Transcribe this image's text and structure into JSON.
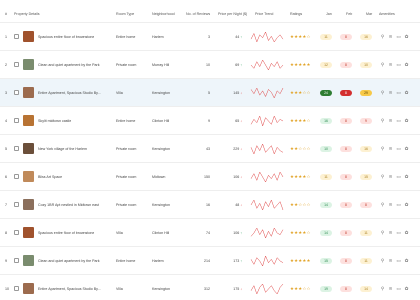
{
  "headers": {
    "idx": "#",
    "property": "Property Details",
    "room": "Room Type",
    "hood": "Neighborhood",
    "reviews": "No. of Reviews",
    "price": "Price per Night ($)",
    "trend": "Price Trend",
    "ratings": "Ratings",
    "jan": "Jan",
    "feb": "Feb",
    "mar": "Mar",
    "amenities": "Amenities"
  },
  "rows": [
    {
      "idx": "1",
      "name": "Spacious entire floor of brownstone",
      "room": "Entire home",
      "hood": "Harlem",
      "reviews": "3",
      "price": "44",
      "dir": "up",
      "stars": "★★★★☆",
      "jan": "11",
      "feb": "8",
      "mar": "16",
      "jan_c": "b-yellow",
      "feb_c": "b-red",
      "mar_c": "b-yellow",
      "thumb": "#a0522d",
      "spark": [
        5,
        9,
        3,
        8,
        6,
        10,
        4,
        7,
        3,
        6,
        8,
        5
      ]
    },
    {
      "idx": "2",
      "name": "Clean and quiet apartment by the Park",
      "room": "Private room",
      "hood": "Murray Hill",
      "reviews": "10",
      "price": "69",
      "dir": "up",
      "stars": "★★★★★",
      "jan": "12",
      "feb": "8",
      "mar": "10",
      "jan_c": "b-yellow",
      "feb_c": "b-red",
      "mar_c": "b-yellow",
      "thumb": "#7a8c6e",
      "spark": [
        6,
        4,
        8,
        5,
        9,
        6,
        3,
        7,
        5,
        8,
        4,
        6
      ]
    },
    {
      "idx": "3",
      "name": "Entire Apartment, Spacious Studio By...",
      "room": "Villa",
      "hood": "Kensington",
      "reviews": "5",
      "price": "145",
      "dir": "down",
      "stars": "★★★☆☆",
      "jan": "24",
      "feb": "8",
      "mar": "29",
      "jan_c": "b-green-solid",
      "feb_c": "b-red-solid",
      "mar_c": "b-yellow-solid",
      "thumb": "#9c6b4e",
      "spark": [
        8,
        5,
        9,
        4,
        7,
        3,
        8,
        6,
        2,
        7,
        5,
        9
      ],
      "selected": true
    },
    {
      "idx": "4",
      "name": "Skylit midtown castle",
      "room": "Entire home",
      "hood": "Clinton Hill",
      "reviews": "9",
      "price": "65",
      "dir": "down",
      "stars": "★★★★☆",
      "jan": "16",
      "feb": "8",
      "mar": "9",
      "jan_c": "b-green",
      "feb_c": "b-red",
      "mar_c": "b-red",
      "thumb": "#b87333",
      "spark": [
        4,
        7,
        5,
        9,
        3,
        8,
        6,
        4,
        9,
        5,
        7,
        6
      ]
    },
    {
      "idx": "5",
      "name": "New York village of the Harlem",
      "room": "Private room",
      "hood": "Kensington",
      "reviews": "43",
      "price": "229",
      "dir": "down",
      "stars": "★★☆☆☆",
      "jan": "10",
      "feb": "8",
      "mar": "16",
      "jan_c": "b-green",
      "feb_c": "b-red",
      "mar_c": "b-yellow",
      "thumb": "#6b4f3a",
      "spark": [
        7,
        3,
        8,
        5,
        9,
        4,
        6,
        8,
        3,
        7,
        5,
        4
      ]
    },
    {
      "idx": "6",
      "name": "Bliss Art Space",
      "room": "Private room",
      "hood": "Midtown",
      "reviews": "150",
      "price": "106",
      "dir": "down",
      "stars": "★★★★☆",
      "jan": "11",
      "feb": "8",
      "mar": "15",
      "jan_c": "b-yellow",
      "feb_c": "b-red",
      "mar_c": "b-yellow",
      "thumb": "#c08a5a",
      "spark": [
        5,
        8,
        4,
        9,
        6,
        3,
        7,
        5,
        8,
        4,
        9,
        6
      ]
    },
    {
      "idx": "7",
      "name": "Cozy 1BR Apt nestled in Midtown east",
      "room": "Private room",
      "hood": "Kensington",
      "reviews": "16",
      "price": "48",
      "dir": "down",
      "stars": "★★☆☆☆",
      "jan": "14",
      "feb": "8",
      "mar": "8",
      "jan_c": "b-green",
      "feb_c": "b-red",
      "mar_c": "b-red",
      "thumb": "#8b6f5c",
      "spark": [
        6,
        9,
        4,
        7,
        3,
        8,
        5,
        9,
        4,
        6,
        8,
        3
      ]
    },
    {
      "idx": "8",
      "name": "Spacious entire floor of brownstone",
      "room": "Villa",
      "hood": "Clinton Hill",
      "reviews": "74",
      "price": "106",
      "dir": "up",
      "stars": "★★★★☆",
      "jan": "14",
      "feb": "8",
      "mar": "11",
      "jan_c": "b-green",
      "feb_c": "b-red",
      "mar_c": "b-yellow",
      "thumb": "#a0522d",
      "spark": [
        4,
        6,
        9,
        5,
        8,
        3,
        7,
        4,
        9,
        6,
        5,
        8
      ]
    },
    {
      "idx": "9",
      "name": "Clean and quiet apartment by the Park",
      "room": "Entire home",
      "hood": "Harlem",
      "reviews": "214",
      "price": "173",
      "dir": "up",
      "stars": "★★★★★",
      "jan": "15",
      "feb": "8",
      "mar": "11",
      "jan_c": "b-green",
      "feb_c": "b-red",
      "mar_c": "b-yellow",
      "thumb": "#7a8c6e",
      "spark": [
        7,
        4,
        8,
        6,
        3,
        9,
        5,
        7,
        4,
        8,
        6,
        5
      ]
    },
    {
      "idx": "10",
      "name": "Entire Apartment, Spacious Studio By...",
      "room": "Villa",
      "hood": "Kensington",
      "reviews": "312",
      "price": "175",
      "dir": "down",
      "stars": "★★★☆☆",
      "jan": "19",
      "feb": "8",
      "mar": "14",
      "jan_c": "b-green",
      "feb_c": "b-red",
      "mar_c": "b-yellow",
      "thumb": "#9c6b4e",
      "spark": [
        5,
        8,
        3,
        7,
        9,
        4,
        6,
        8,
        5,
        3,
        7,
        9
      ]
    }
  ],
  "colors": {
    "accent": "#e04848",
    "up": "#2e9e5b",
    "down": "#e04848",
    "star": "#e2a429",
    "selected_row": "#eef5fa"
  },
  "amenity_icons": [
    "person-icon",
    "wifi-icon",
    "tv-icon",
    "pet-icon"
  ]
}
